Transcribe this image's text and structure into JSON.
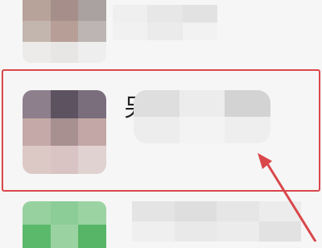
{
  "screen": {
    "background": "#f6f6f6",
    "highlight_color": "#d9474a"
  },
  "rows": [
    {
      "id": "row-1",
      "avatar_blurred": true
    },
    {
      "id": "row-2",
      "avatar_blurred": true,
      "name_first_char": "另",
      "name_rest_blurred": true,
      "highlighted": true
    },
    {
      "id": "row-3",
      "avatar_blurred": true
    }
  ]
}
